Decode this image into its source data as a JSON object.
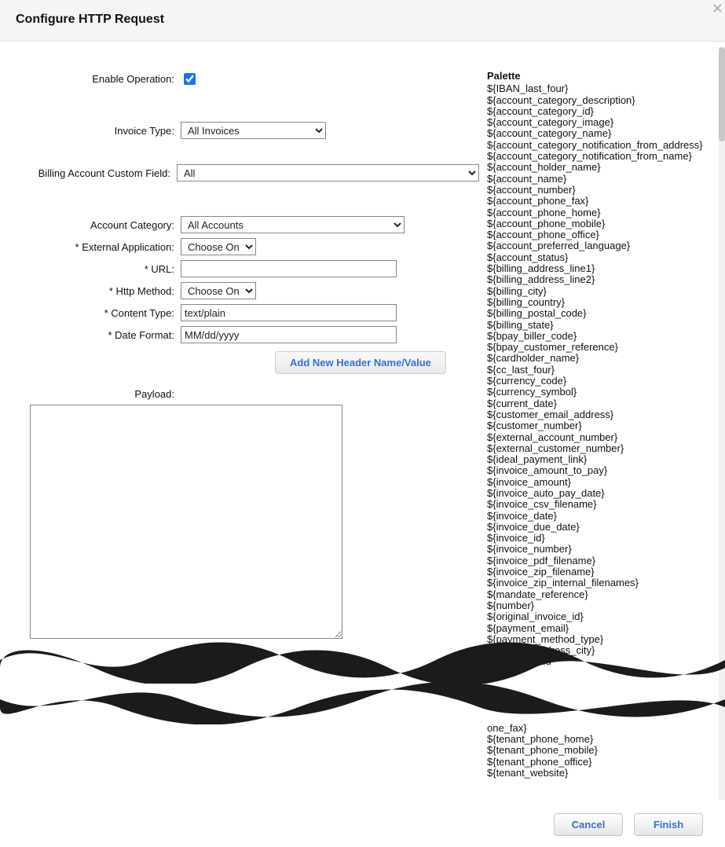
{
  "header": {
    "title": "Configure HTTP Request"
  },
  "form": {
    "enable_operation": {
      "label": "Enable Operation:",
      "checked": true
    },
    "invoice_type": {
      "label": "Invoice Type:",
      "selected": "All Invoices"
    },
    "billing_custom_field": {
      "label": "Billing Account Custom Field:",
      "selected": "All"
    },
    "account_category": {
      "label": "Account Category:",
      "selected": "All Accounts"
    },
    "external_app": {
      "label": "* External Application:",
      "selected": "Choose One"
    },
    "url": {
      "label": "* URL:",
      "value": ""
    },
    "http_method": {
      "label": "* Http Method:",
      "selected": "Choose One"
    },
    "content_type": {
      "label": "* Content Type:",
      "value": "text/plain"
    },
    "date_format": {
      "label": "* Date Format:",
      "value": "MM/dd/yyyy"
    },
    "add_header_btn": "Add New Header Name/Value",
    "payload": {
      "label": "Payload:",
      "value": ""
    }
  },
  "palette": {
    "title": "Palette",
    "items_top": [
      "${IBAN_last_four}",
      "${account_category_description}",
      "${account_category_id}",
      "${account_category_image}",
      "${account_category_name}",
      "${account_category_notification_from_address}",
      "${account_category_notification_from_name}",
      "${account_holder_name}",
      "${account_name}",
      "${account_number}",
      "${account_phone_fax}",
      "${account_phone_home}",
      "${account_phone_mobile}",
      "${account_phone_office}",
      "${account_preferred_language}",
      "${account_status}",
      "${billing_address_line1}",
      "${billing_address_line2}",
      "${billing_city}",
      "${billing_country}",
      "${billing_postal_code}",
      "${billing_state}",
      "${bpay_biller_code}",
      "${bpay_customer_reference}",
      "${cardholder_name}",
      "${cc_last_four}",
      "${currency_code}",
      "${currency_symbol}",
      "${current_date}",
      "${customer_email_address}",
      "${customer_number}",
      "${external_account_number}",
      "${external_customer_number}",
      "${ideal_payment_link}",
      "${invoice_amount_to_pay}",
      "${invoice_amount}",
      "${invoice_auto_pay_date}",
      "${invoice_csv_filename}",
      "${invoice_date}",
      "${invoice_due_date}",
      "${invoice_id}",
      "${invoice_number}",
      "${invoice_pdf_filename}",
      "${invoice_zip_filename}",
      "${invoice_zip_internal_filenames}",
      "${mandate_reference}",
      "${number}",
      "${original_invoice_id}",
      "${payment_email}",
      "${payment_method_type}",
      "${service_address_city}",
      "${service_add"
    ],
    "items_bottom": [
      "one_fax}",
      "${tenant_phone_home}",
      "${tenant_phone_mobile}",
      "${tenant_phone_office}",
      "${tenant_website}"
    ]
  },
  "footer": {
    "cancel": "Cancel",
    "finish": "Finish"
  }
}
